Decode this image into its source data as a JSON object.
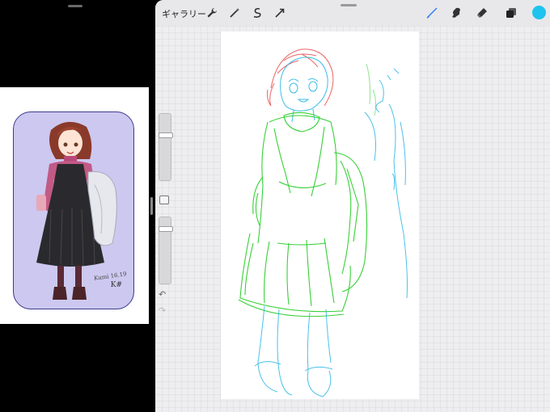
{
  "toolbar": {
    "gallery_label": "ギャラリー",
    "left_tools": [
      "wrench-icon",
      "magic-wand-icon",
      "selection-icon",
      "transform-icon"
    ],
    "right_tools": [
      "brush-icon",
      "smudge-icon",
      "eraser-icon",
      "layers-icon",
      "color-swatch"
    ],
    "active_color": "#1ec3ee",
    "active_tool_color": "#2f7bf5"
  },
  "reference": {
    "signature_line1": "Kumi 16.19",
    "signature_line2": "K#"
  },
  "colors": {
    "sketch_blue": "#2bb7e6",
    "sketch_green": "#22cc22",
    "sketch_red": "#e84a4a",
    "ref_background": "#ccc8f0",
    "ref_border": "#3c3c8c"
  },
  "sidebar": {
    "brush_size_level": 0.3,
    "opacity_level": 0.15,
    "undo_icon": "undo-icon",
    "redo_icon": "redo-icon",
    "modify_icon": "square-modify-icon"
  }
}
